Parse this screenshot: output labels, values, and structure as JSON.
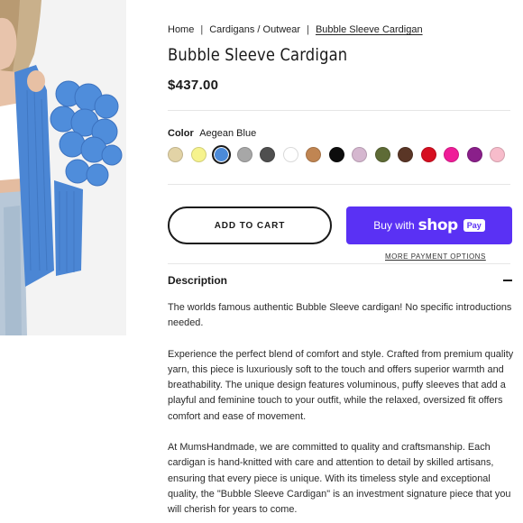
{
  "breadcrumb": {
    "home": "Home",
    "category": "Cardigans / Outwear",
    "current": "Bubble Sleeve Cardigan",
    "separator": "|"
  },
  "product": {
    "title": "Bubble Sleeve Cardigan",
    "price": "$437.00"
  },
  "color": {
    "label": "Color",
    "selected": "Aegean Blue",
    "swatches": [
      "#e2d3a6",
      "#f6f38d",
      "#4b8ad8",
      "#a7a7a7",
      "#4f4f4f",
      "#ffffff",
      "#c08552",
      "#0d0d0d",
      "#d5b7cf",
      "#5e6b36",
      "#5a3626",
      "#d60f20",
      "#ef1d98",
      "#8a1f8a",
      "#f7bccb"
    ],
    "selected_index": 2
  },
  "buttons": {
    "add_to_cart": "ADD TO CART",
    "buy_with": "Buy with",
    "shop": "shop",
    "pay": "Pay",
    "more_options": "MORE PAYMENT OPTIONS"
  },
  "description": {
    "heading": "Description",
    "paragraphs": [
      "The worlds famous authentic Bubble Sleeve cardigan! No specific introductions needed.",
      "Experience the perfect blend of comfort and style. Crafted from premium quality yarn, this piece is luxuriously soft to the touch and offers superior warmth and breathability. The unique design features voluminous, puffy sleeves that add a playful and feminine touch to your outfit, while the relaxed, oversized fit offers comfort and ease of movement.",
      "At MumsHandmade, we are committed to quality and craftsmanship. Each cardigan is hand-knitted with care and attention to detail by skilled artisans, ensuring that every piece is unique. With its timeless style and exceptional quality, the \"Bubble Sleeve Cardigan\" is an investment signature piece that you will cherish for years to come."
    ]
  }
}
